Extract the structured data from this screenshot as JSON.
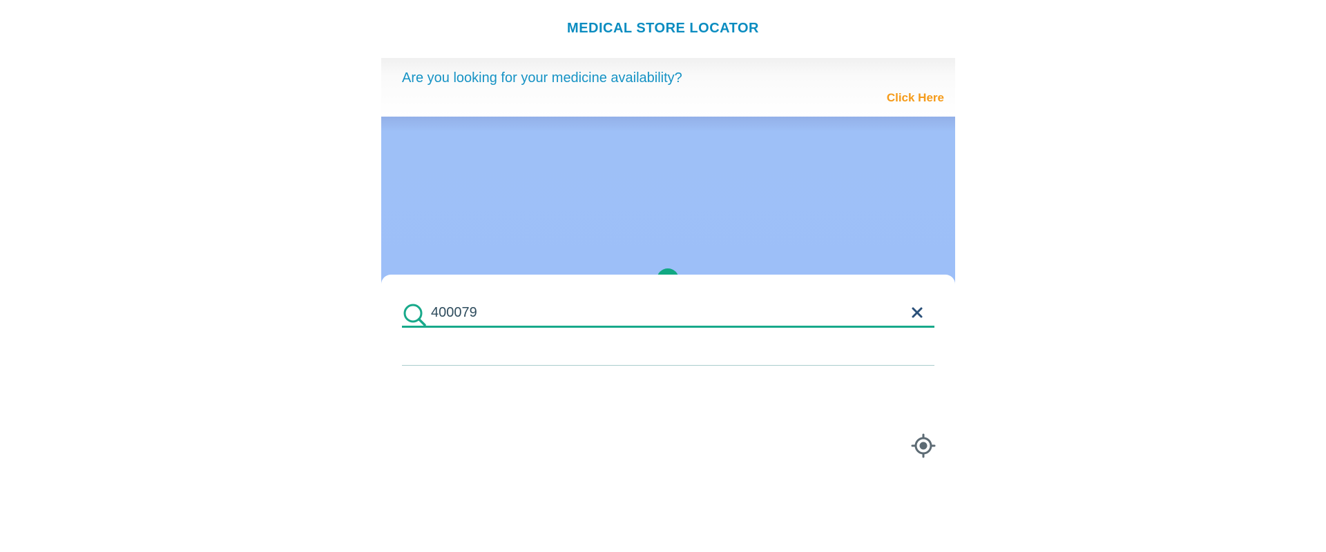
{
  "header": {
    "title": "MEDICAL STORE LOCATOR"
  },
  "banner": {
    "question": "Are you looking for your medicine availability?",
    "link_label": "Click Here"
  },
  "search": {
    "value": "400079",
    "icon": "search-icon",
    "clear_icon": "close-icon"
  },
  "map": {
    "locate_icon": "crosshair-icon"
  },
  "colors": {
    "accent": "#0a8cc0",
    "link": "#f59b1a",
    "search_underline": "#18a98a",
    "map_water": "#9dbff8"
  }
}
